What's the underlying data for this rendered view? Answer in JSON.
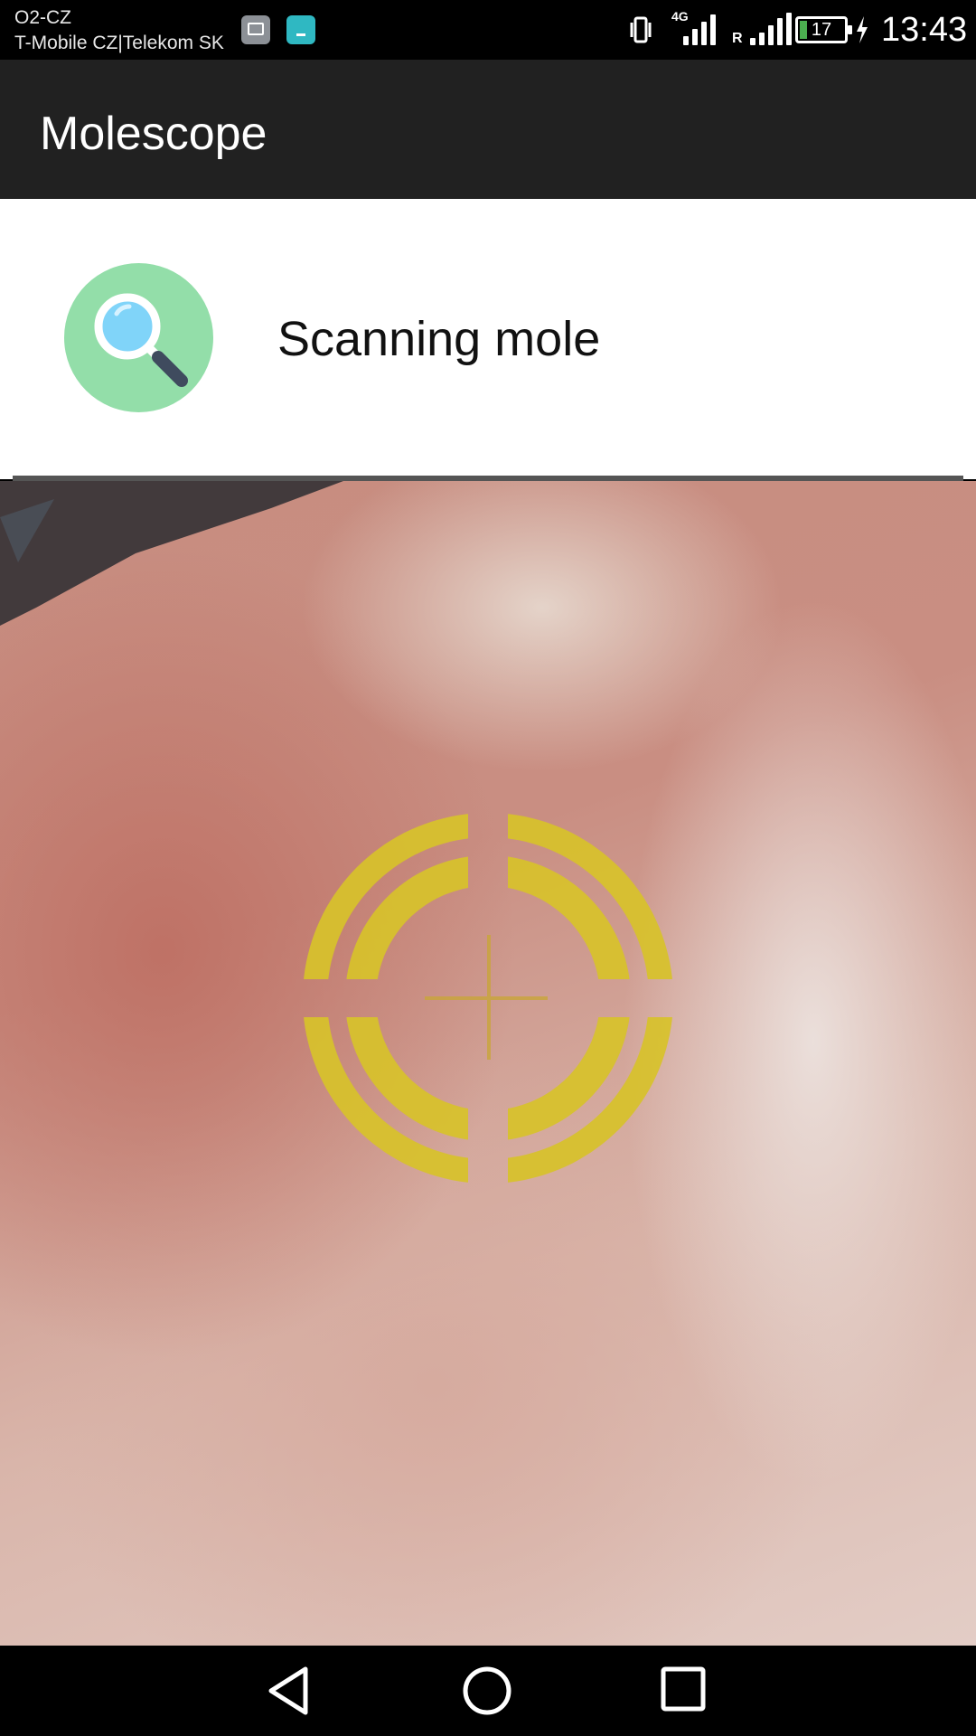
{
  "status_bar": {
    "carrier_primary": "O2-CZ",
    "carrier_secondary": "T-Mobile CZ|Telekom SK",
    "notification_icons": [
      "gallery-icon",
      "download-icon"
    ],
    "network_tag": "4G",
    "roaming_tag": "R",
    "battery_level": "17",
    "battery_fraction": 0.17,
    "time": "13:43"
  },
  "app_bar": {
    "title": "Molescope"
  },
  "status_card": {
    "icon": "magnifier-icon",
    "label": "Scanning mole"
  },
  "camera": {
    "overlay": "target-reticle-icon",
    "reticle_color": "#d8c22c"
  },
  "nav_bar": {
    "buttons": [
      "back-icon",
      "home-icon",
      "recents-icon"
    ]
  },
  "colors": {
    "app_bar": "#212121",
    "avatar_bg": "#93dea9",
    "progress_track": "#555555"
  }
}
